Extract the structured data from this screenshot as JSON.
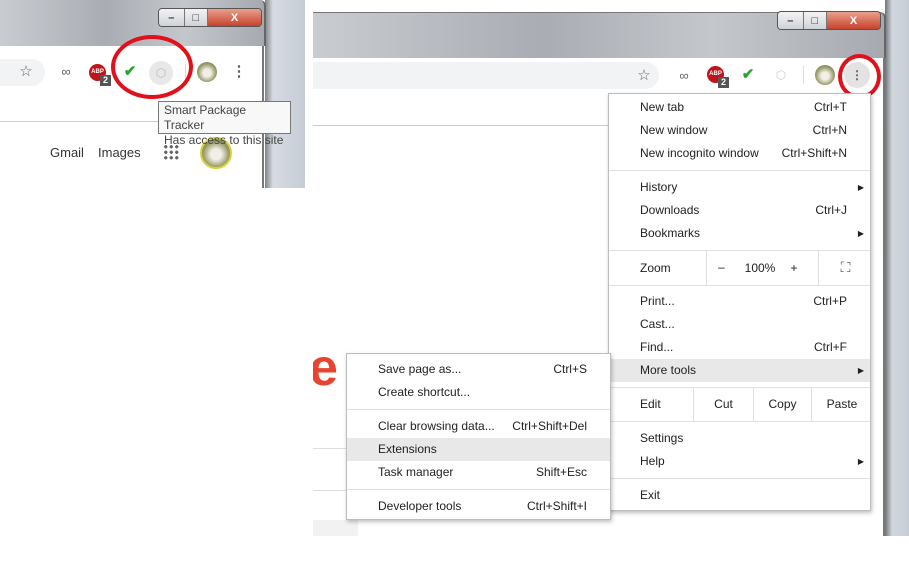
{
  "left_panel": {
    "window_controls": {
      "minimize": "–",
      "maximize": "□",
      "close": "X"
    },
    "abp_badge": "2",
    "abp_label": "ABP",
    "tooltip": {
      "title": "Smart Package Tracker",
      "subtitle": "Has access to this site"
    },
    "links": {
      "gmail": "Gmail",
      "images": "Images"
    }
  },
  "right_panel": {
    "window_controls": {
      "minimize": "–",
      "maximize": "□",
      "close": "X"
    },
    "abp_badge": "2",
    "abp_label": "ABP",
    "menu": {
      "new_tab": {
        "label": "New tab",
        "shortcut": "Ctrl+T"
      },
      "new_window": {
        "label": "New window",
        "shortcut": "Ctrl+N"
      },
      "incognito": {
        "label": "New incognito window",
        "shortcut": "Ctrl+Shift+N"
      },
      "history": {
        "label": "History"
      },
      "downloads": {
        "label": "Downloads",
        "shortcut": "Ctrl+J"
      },
      "bookmarks": {
        "label": "Bookmarks"
      },
      "zoom": {
        "label": "Zoom",
        "minus": "–",
        "value": "100%",
        "plus": "+"
      },
      "print": {
        "label": "Print...",
        "shortcut": "Ctrl+P"
      },
      "cast": {
        "label": "Cast..."
      },
      "find": {
        "label": "Find...",
        "shortcut": "Ctrl+F"
      },
      "more_tools": {
        "label": "More tools"
      },
      "edit": {
        "label": "Edit",
        "cut": "Cut",
        "copy": "Copy",
        "paste": "Paste"
      },
      "settings": {
        "label": "Settings"
      },
      "help": {
        "label": "Help"
      },
      "exit": {
        "label": "Exit"
      }
    },
    "submenu": {
      "save_page": {
        "label": "Save page as...",
        "shortcut": "Ctrl+S"
      },
      "create_shortcut": {
        "label": "Create shortcut..."
      },
      "clear_data": {
        "label": "Clear browsing data...",
        "shortcut": "Ctrl+Shift+Del"
      },
      "extensions": {
        "label": "Extensions"
      },
      "task_manager": {
        "label": "Task manager",
        "shortcut": "Shift+Esc"
      },
      "dev_tools": {
        "label": "Developer tools",
        "shortcut": "Ctrl+Shift+I"
      }
    },
    "logo_letter": "e"
  },
  "colors": {
    "highlight_ring": "#e0111b",
    "menu_hover": "#e8e8e9"
  }
}
